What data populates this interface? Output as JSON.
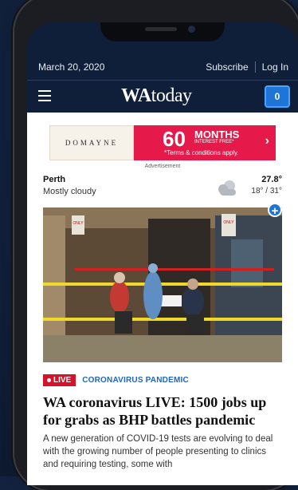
{
  "topbar": {
    "date": "March 20, 2020",
    "subscribe_label": "Subscribe",
    "login_label": "Log In"
  },
  "masthead": {
    "logo_bold": "WA",
    "logo_light": "today",
    "notification_count": "0"
  },
  "ad": {
    "brand": "DOMAYNE",
    "headline_number": "60",
    "headline_word": "MONTHS",
    "subline": "INTEREST FREE*",
    "terms": "*Terms & conditions apply.",
    "label": "Advertisement"
  },
  "weather": {
    "city": "Perth",
    "condition": "Mostly cloudy",
    "icon": "cloud-icon",
    "current": "27.8°",
    "range": "18° / 31°"
  },
  "article": {
    "live_label": "LIVE",
    "section": "CORONAVIRUS PANDEMIC",
    "headline": "WA coronavirus LIVE: 1500 jobs up for grabs as BHP battles pandemic",
    "summary": "A new generation of COVID-19 tests are evolving to deal with the growing number of people presenting to clinics and requiring testing, some with",
    "image_signs": [
      "ONLY",
      "ONLY"
    ]
  },
  "colors": {
    "background": "#13233f",
    "accent": "#1f74d8",
    "live_red": "#d6122b",
    "ad_pink": "#e6194b"
  }
}
